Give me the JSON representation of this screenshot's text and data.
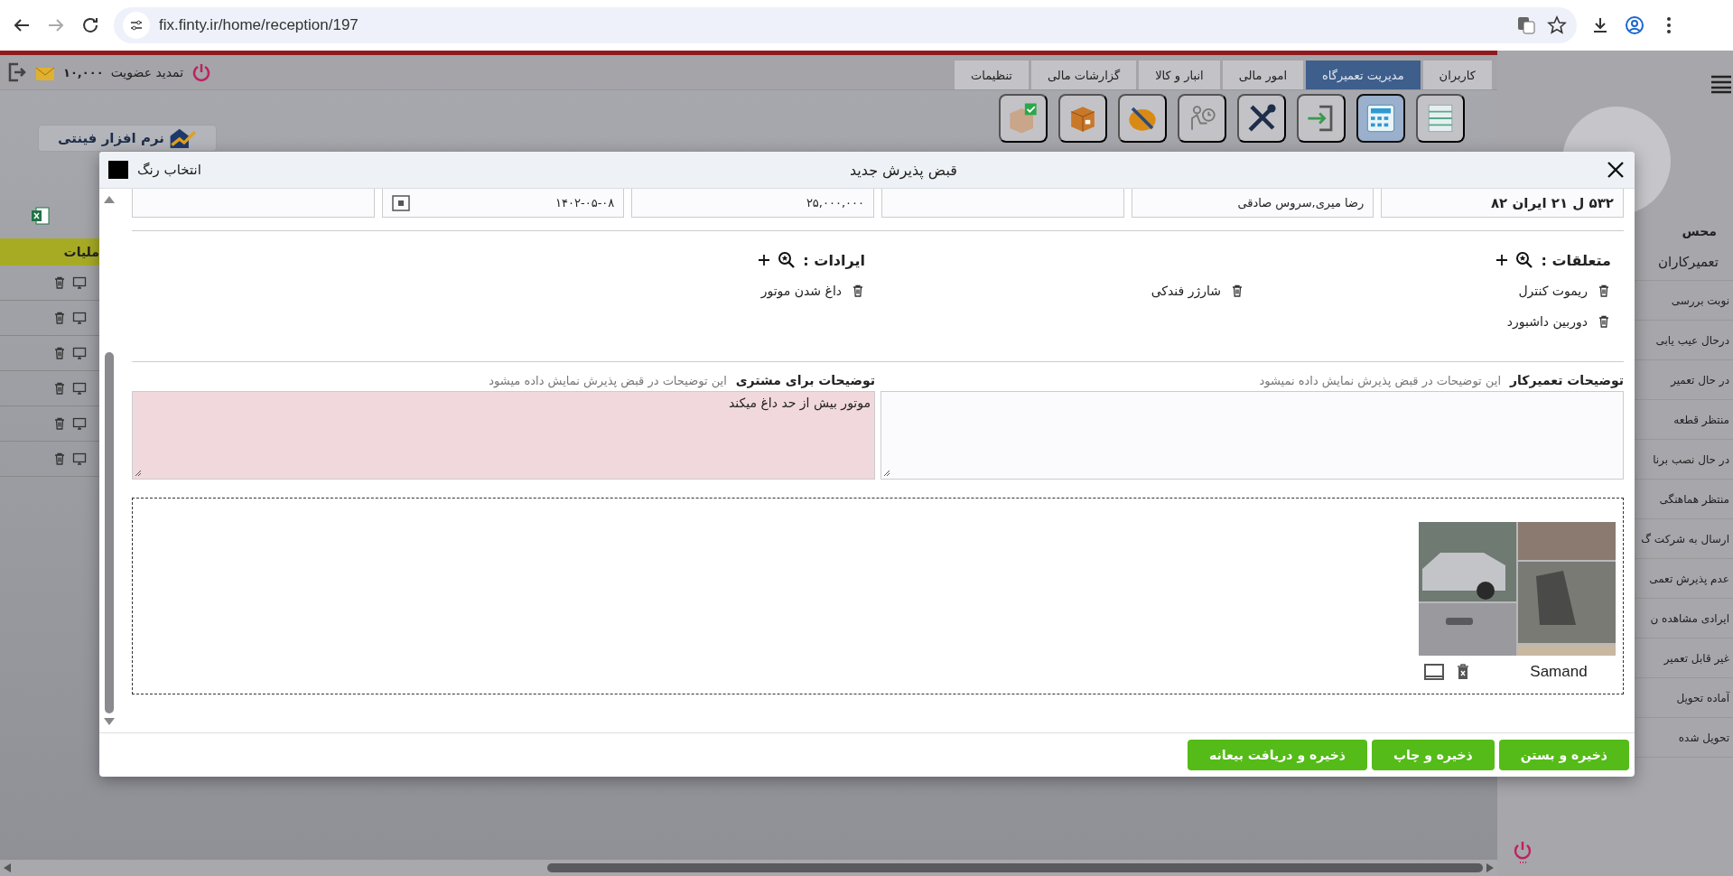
{
  "browser": {
    "url": "fix.finty.ir/home/reception/197"
  },
  "topbar": {
    "credit": "۱۰,۰۰۰",
    "renew": "تمدید عضویت"
  },
  "tabs": [
    {
      "label": "کاربران",
      "selected": false
    },
    {
      "label": "مدیریت تعمیرگاه",
      "selected": true
    },
    {
      "label": "امور مالی",
      "selected": false
    },
    {
      "label": "انبار و کالا",
      "selected": false
    },
    {
      "label": "گزارشات مالی",
      "selected": false
    },
    {
      "label": "تنظیمات",
      "selected": false
    }
  ],
  "toolbar": [
    {
      "kind": "shelves",
      "selected": false
    },
    {
      "kind": "calculator",
      "selected": true
    },
    {
      "kind": "enter",
      "selected": false
    },
    {
      "kind": "tools",
      "selected": false
    },
    {
      "kind": "waiting",
      "selected": false
    },
    {
      "kind": "soldering",
      "selected": false
    },
    {
      "kind": "box",
      "selected": false
    },
    {
      "kind": "boxcheck",
      "selected": false
    }
  ],
  "logo": {
    "text": "نرم افزار فینتی"
  },
  "table": {
    "header": "ملیات",
    "rows": [
      {
        "kind": "actions"
      },
      {
        "kind": "actions"
      },
      {
        "kind": "actions"
      },
      {
        "kind": "actions"
      },
      {
        "kind": "actions"
      },
      {
        "kind": "actions"
      }
    ]
  },
  "sidebar": {
    "user": "محس",
    "section": "تعمیرکاران",
    "items": [
      "نوبت بررسی",
      "درحال عیب یابی",
      "در حال تعمیر",
      "منتظر قطعه",
      "در حال نصب برنا",
      "منتظر هماهنگی",
      "ارسال به شرکت گ",
      "عدم پذیرش تعمی",
      "ایرادی مشاهده ن",
      "غیر قابل تعمیر",
      "آماده تحویل",
      "تحویل شده"
    ]
  },
  "dialog": {
    "title": "قبض پذیرش جدید",
    "color_label": "انتخاب رنگ",
    "fields": [
      {
        "kind": "plate",
        "value": "۵۳۲ ل ۲۱ ایران ۸۲"
      },
      {
        "kind": "text",
        "value": "رضا میری,سروس صادقی"
      },
      {
        "kind": "empty"
      },
      {
        "kind": "text",
        "value": "۲۵,۰۰۰,۰۰۰"
      },
      {
        "kind": "date",
        "value": "۱۴۰۲-۰۵-۰۸"
      },
      {
        "kind": "empty"
      }
    ],
    "attachments": {
      "label": "متعلقات :",
      "items": [
        "ریموت کنترل",
        "شارژر فندکی",
        "دوربین داشبورد"
      ]
    },
    "defects": {
      "label": "ایرادات :",
      "items": [
        "داغ شدن موتور"
      ]
    },
    "notes": [
      {
        "kind": "internal",
        "label": "توضیحات تعمیرکار",
        "hint": "این توضیحات در قبض پذیرش نمایش داده نمیشود"
      },
      {
        "kind": "customer",
        "label": "توضیحات برای مشتری",
        "hint": "این توضیحات در قبض پذیرش نمایش داده میشود",
        "value": "موتور بیش از حد داغ میکند"
      }
    ],
    "gallery": {
      "caption": "Samand"
    },
    "buttons": [
      "ذخیره و بستن",
      "ذخیره و چاپ",
      "ذخیره و دریافت بیعانه"
    ]
  }
}
